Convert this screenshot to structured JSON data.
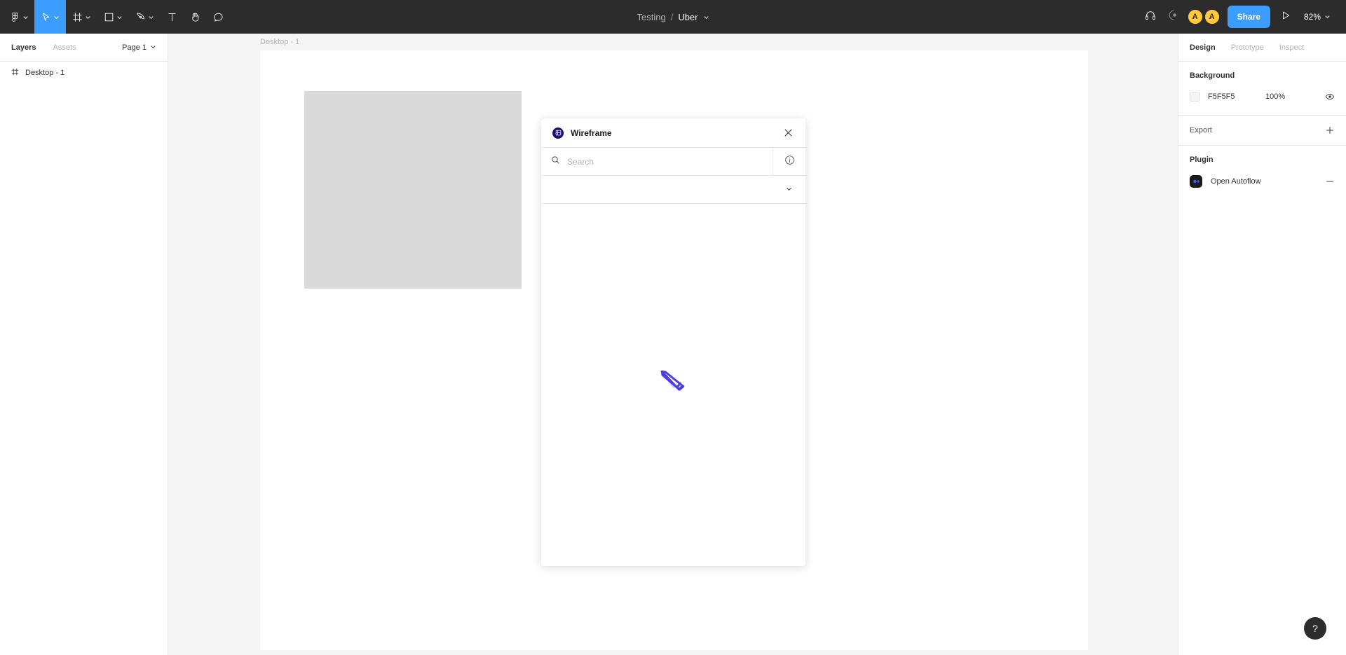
{
  "toolbar": {
    "menu_icon": "figma-logo-icon",
    "tools": [
      {
        "name": "move-tool",
        "icon": "cursor-icon",
        "has_caret": true,
        "active": true
      },
      {
        "name": "frame-tool",
        "icon": "frame-icon",
        "has_caret": true,
        "active": false
      },
      {
        "name": "shape-tool",
        "icon": "rectangle-icon",
        "has_caret": true,
        "active": false
      },
      {
        "name": "pen-tool",
        "icon": "pen-icon",
        "has_caret": true,
        "active": false
      },
      {
        "name": "text-tool",
        "icon": "text-icon",
        "has_caret": false,
        "active": false
      },
      {
        "name": "hand-tool",
        "icon": "hand-icon",
        "has_caret": false,
        "active": false
      },
      {
        "name": "comment-tool",
        "icon": "comment-icon",
        "has_caret": false,
        "active": false
      }
    ],
    "breadcrumb": {
      "project": "Testing",
      "separator": "/",
      "file": "Uber"
    },
    "right": {
      "audio_icon": "headphones-icon",
      "observe_icon": "observation-mode-icon",
      "avatars": [
        {
          "initial": "A",
          "color": "#FFC83D"
        },
        {
          "initial": "A",
          "color": "#FFC83D"
        }
      ],
      "share_label": "Share",
      "present_icon": "play-icon",
      "zoom_label": "82%"
    },
    "accent_color": "#3B9EFF",
    "background_color": "#2C2C2C"
  },
  "left_panel": {
    "tabs": [
      {
        "label": "Layers",
        "active": true
      },
      {
        "label": "Assets",
        "active": false
      }
    ],
    "page_selector": "Page 1",
    "layers": [
      {
        "name": "Desktop - 1",
        "icon": "frame-icon"
      }
    ]
  },
  "canvas": {
    "frame_label": "Desktop - 1",
    "frame_background": "#FFFFFF",
    "rectangle_fill": "#D9D9D9",
    "canvas_background": "#F5F5F5"
  },
  "plugin_modal": {
    "logo_icon": "wireframe-plugin-icon",
    "title": "Wireframe",
    "close_icon": "close-icon",
    "search": {
      "icon": "search-icon",
      "placeholder": "Search",
      "value": ""
    },
    "info_icon": "info-icon",
    "filter_caret_icon": "chevron-down-icon",
    "loading_icon": "pencil-icon",
    "loading_color": "#4B3FE4"
  },
  "right_panel": {
    "tabs": [
      {
        "label": "Design",
        "active": true
      },
      {
        "label": "Prototype",
        "active": false
      },
      {
        "label": "Inspect",
        "active": false
      }
    ],
    "background": {
      "title": "Background",
      "hex": "F5F5F5",
      "swatch_color": "#F5F5F5",
      "opacity": "100%",
      "visibility_icon": "eye-icon"
    },
    "export": {
      "title": "Export",
      "add_icon": "plus-icon"
    },
    "plugin": {
      "title": "Plugin",
      "items": [
        {
          "name": "Open Autoflow",
          "icon": "autoflow-icon",
          "action_icon": "minus-icon"
        }
      ]
    }
  },
  "help": {
    "label": "?"
  }
}
